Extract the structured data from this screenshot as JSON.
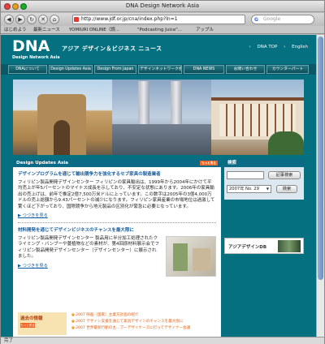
{
  "window": {
    "title": "DNA Design Network Asia"
  },
  "browser": {
    "url": "http://www.jdf.or.jp/cna/index.php?ln=1",
    "search_placeholder": "Google",
    "status": "完了"
  },
  "bookmarks": [
    "はじめよう",
    "最新ニュース",
    "YOMIURI ONLINE（読...",
    "\"Podcasting Juice\"...",
    "アップル"
  ],
  "site": {
    "logo": "DNA",
    "logo_sub": "Design Network Asia",
    "tagline": "アジア デザイン＆ビジネス ニュース",
    "top_links": [
      "DNA TOP",
      "English"
    ],
    "nav": [
      "DNAについて",
      "Design Updates Asia",
      "Design From Japan",
      "デザインネットワーク会議",
      "DNA NEWS",
      "お問い合わせ",
      "カウンターパート"
    ]
  },
  "main": {
    "section_title": "Design Updates Asia",
    "more_label": "もっと見る",
    "articles": [
      {
        "title": "デザインプログラムを通じて輸出競争力を強化するセブ家具の製造業者",
        "body": "フィリピン製品開発デザインセンター フィリピンの家具輸出は、1999年から2004年にかけて平均売上が年5パーセントのマイナス成長を示しており、不安定な状態にあります。2006年の家具輸出の売上げは、前年で推定2億7,500万米ドルに上っています。この数字は2005年の3億4,000万ドルの売上総額から9.43パーセントの減少になります。フィリピン家具産業の市場地位は過激して驚くほど下がっており、国際競争から地元製品の区別化が緊急に必要となっています。",
        "read_more": "つづきを見る"
      },
      {
        "title": "材料開発を通じてデザインビジネスのチャンスを最大限に",
        "body": "フィリピン製品開発デザインセンター 製品用に半分加工処理されたクライミング・バンブーや蔓植物などの素材が、第4回原材料展示会でフィリピン製品開発デザインセンター（デザインセンター）に展示されました。",
        "read_more": "つづきを見る"
      }
    ],
    "past": {
      "title": "過去の情報",
      "more_label": "もっと見る",
      "items": [
        "2007 映画（国家）主業方計画の紹介",
        "2007 デザイン支援を通じて家具デザインのチャンスを最大限に",
        "2007 世界最新行動の主…ブーデザイナーズに打ってデザイナー会議"
      ]
    }
  },
  "sidebar": {
    "search_title": "検索",
    "keyword_button": "記事検索",
    "date_value": "2007年 No. 29",
    "search_button": "検索",
    "db_label": "アジアデザインDB"
  }
}
